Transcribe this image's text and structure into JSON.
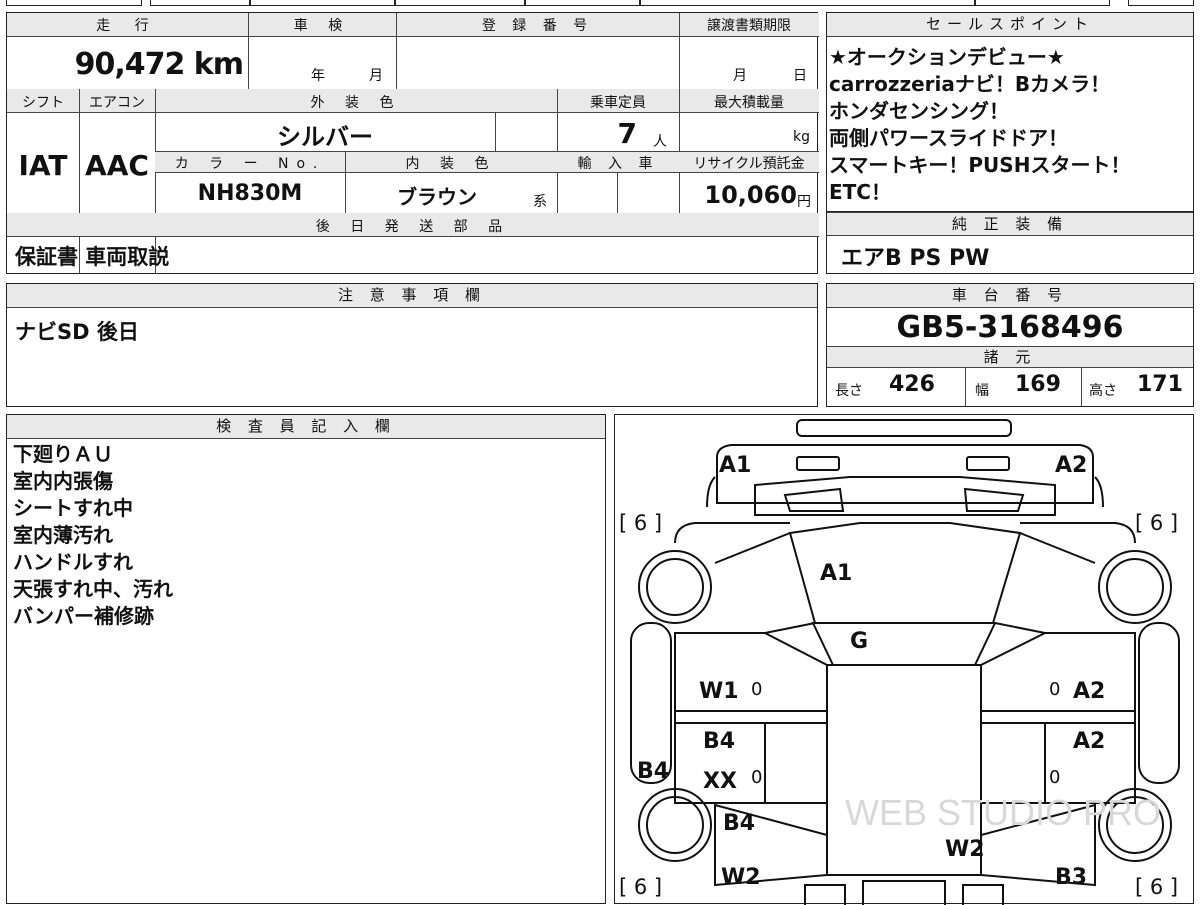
{
  "specs": {
    "mileage_label": "走 行",
    "mileage_value": "90,472 km",
    "shaken_label": "車 検",
    "shaken_year": "年",
    "shaken_month": "月",
    "registration_label": "登 録 番 号",
    "transfer_deadline_label": "譲渡書類期限",
    "transfer_month": "月",
    "transfer_day": "日",
    "shift_label": "シフト",
    "shift_value": "IAT",
    "aircon_label": "エアコン",
    "aircon_value": "AAC",
    "exterior_color_label": "外 装 色",
    "exterior_color_value": "シルバー",
    "capacity_label": "乗車定員",
    "capacity_value": "7",
    "capacity_unit": "人",
    "max_load_label": "最大積載量",
    "max_load_unit": "kg",
    "color_no_label": "カ ラ ー No.",
    "color_no_value": "NH830M",
    "interior_color_label": "内 装 色",
    "interior_color_value": "ブラウン",
    "interior_suffix": "系",
    "import_label": "輸 入 車",
    "recycle_label": "リサイクル預託金",
    "recycle_value": "10,060",
    "recycle_unit": "円"
  },
  "later_parts": {
    "label": "後 日 発 送 部 品",
    "value": "保証書 車両取説"
  },
  "sales_points": {
    "label": "セールスポイント",
    "lines": [
      "★オークションデビュー★",
      "carrozzeriaナビ！Bカメラ！",
      "ホンダセンシング！",
      "両側パワースライドドア！",
      "スマートキー！PUSHスタート！",
      "ETC！"
    ]
  },
  "equipment": {
    "label": "純 正 装 備",
    "value": "エアB PS PW"
  },
  "notes": {
    "label": "注 意 事 項 欄",
    "value": "ナビSD 後日"
  },
  "chassis": {
    "label": "車 台 番 号",
    "value": "GB5-3168496",
    "dims_label": "諸 元",
    "length_label": "長さ",
    "length_value": "426",
    "width_label": "幅",
    "width_value": "169",
    "height_label": "高さ",
    "height_value": "171"
  },
  "inspector": {
    "label": "検 査 員 記 入 欄",
    "lines": [
      "下廻りＡＵ",
      "室内内張傷",
      "シートすれ中",
      "室内薄汚れ",
      "ハンドルすれ",
      "天張すれ中、汚れ",
      "バンパー補修跡"
    ]
  },
  "diagram": {
    "marks": {
      "front_left": "A1",
      "front_right": "A2",
      "windshield": "A1",
      "roof": "G",
      "left_front_door": "W1",
      "right_front_door": "A2",
      "left_rear_door_1": "B4",
      "left_rear_door_2": "XX",
      "right_rear_door": "A2",
      "left_side": "B4",
      "left_rear_quarter": "B4",
      "left_rear_bumper": "W2",
      "rear_center": "W2",
      "right_rear_bumper": "B3",
      "zero": "0"
    },
    "tires": {
      "front_left": "[ 6 ]",
      "front_right": "[ 6 ]",
      "rear_left": "[ 6 ]",
      "rear_right": "[ 6 ]"
    },
    "watermark": "WEB STUDIO PRO"
  }
}
